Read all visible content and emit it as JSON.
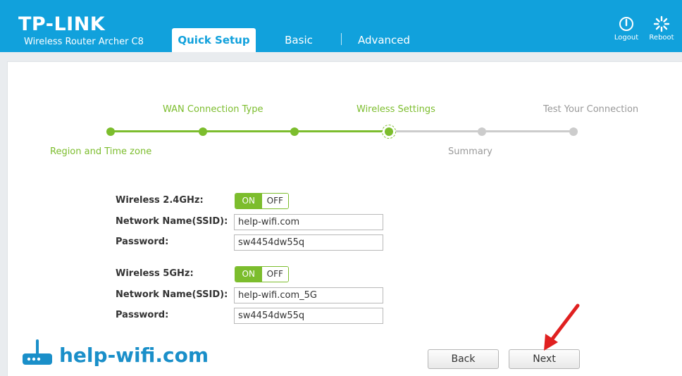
{
  "header": {
    "brand": "TP-LINK",
    "model": "Wireless Router Archer C8",
    "tabs": [
      {
        "label": "Quick Setup",
        "active": true
      },
      {
        "label": "Basic",
        "active": false
      },
      {
        "label": "Advanced",
        "active": false
      }
    ],
    "logout_label": "Logout",
    "reboot_label": "Reboot"
  },
  "stepper": {
    "steps": [
      {
        "label": "Region and Time zone",
        "state": "done"
      },
      {
        "label": "WAN Connection Type",
        "state": "done"
      },
      {
        "label": "",
        "state": "done"
      },
      {
        "label": "Wireless Settings",
        "state": "current"
      },
      {
        "label": "Summary",
        "state": "pending"
      },
      {
        "label": "Test Your Connection",
        "state": "pending"
      }
    ]
  },
  "form": {
    "wireless_24": {
      "label": "Wireless 2.4GHz:",
      "on_label": "ON",
      "off_label": "OFF",
      "ssid_label": "Network Name(SSID):",
      "ssid_value": "help-wifi.com",
      "password_label": "Password:",
      "password_value": "sw4454dw55q"
    },
    "wireless_5": {
      "label": "Wireless 5GHz:",
      "on_label": "ON",
      "off_label": "OFF",
      "ssid_label": "Network Name(SSID):",
      "ssid_value": "help-wifi.com_5G",
      "password_label": "Password:",
      "password_value": "sw4454dw55q"
    }
  },
  "buttons": {
    "back": "Back",
    "next": "Next"
  },
  "watermark": {
    "text": "help-wifi.com"
  },
  "colors": {
    "header_bg": "#11a1dc",
    "accent_green": "#7cbd2d",
    "arrow_red": "#e02020"
  }
}
